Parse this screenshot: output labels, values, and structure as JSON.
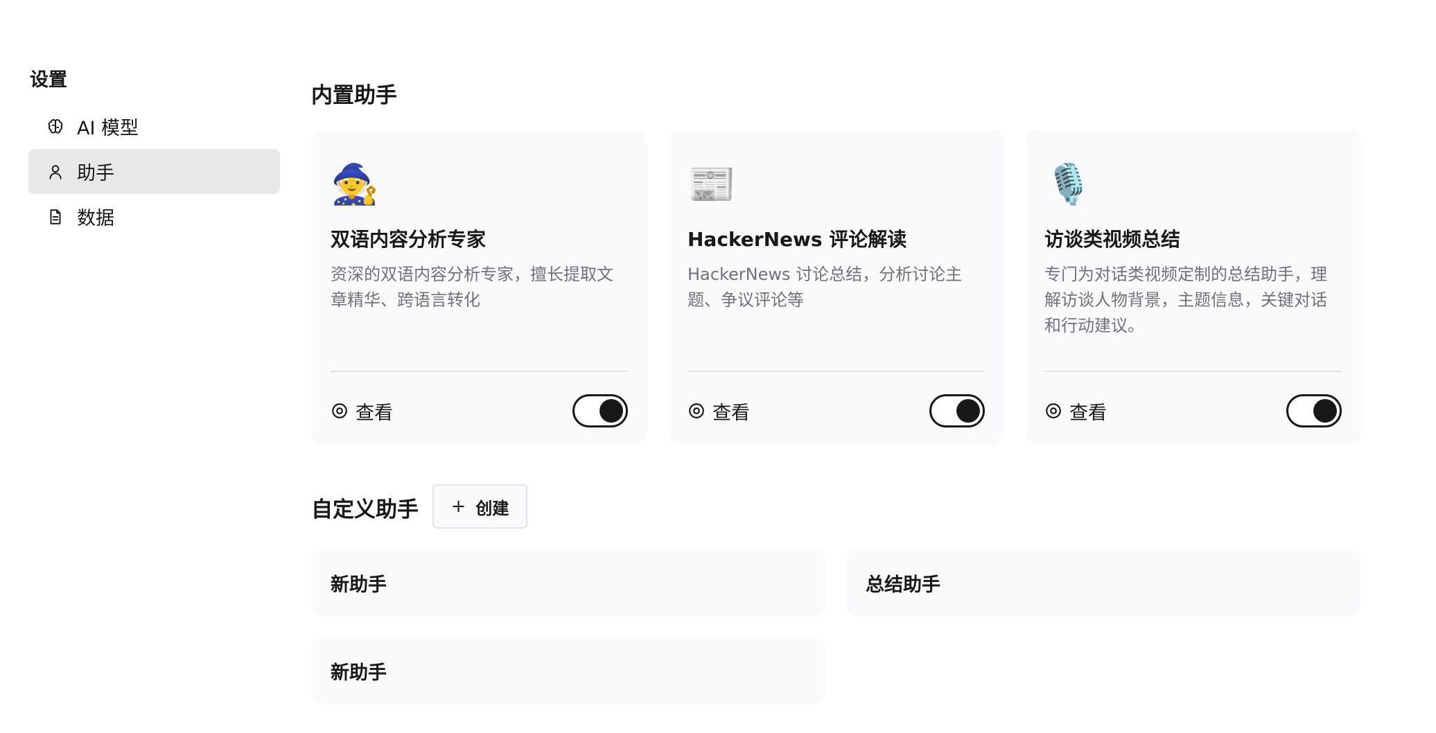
{
  "sidebar": {
    "title": "设置",
    "items": [
      {
        "label": "AI 模型",
        "icon": "brain-icon"
      },
      {
        "label": "助手",
        "icon": "user-icon"
      },
      {
        "label": "数据",
        "icon": "document-icon"
      }
    ]
  },
  "builtin": {
    "title": "内置助手",
    "cards": [
      {
        "emoji": "🧙",
        "title": "双语内容分析专家",
        "desc": "资深的双语内容分析专家，擅长提取文章精华、跨语言转化",
        "view_label": "查看",
        "enabled": true
      },
      {
        "emoji": "📰",
        "title": "HackerNews 评论解读",
        "desc": "HackerNews 讨论总结，分析讨论主题、争议评论等",
        "view_label": "查看",
        "enabled": true
      },
      {
        "emoji": "🎙️",
        "title": "访谈类视频总结",
        "desc": "专门为对话类视频定制的总结助手，理解访谈人物背景，主题信息，关键对话和行动建议。",
        "view_label": "查看",
        "enabled": true
      }
    ]
  },
  "custom": {
    "title": "自定义助手",
    "create_label": "创建",
    "create_icon": "+",
    "cards": [
      {
        "title": "新助手"
      },
      {
        "title": "总结助手"
      },
      {
        "title": "新助手"
      }
    ]
  }
}
